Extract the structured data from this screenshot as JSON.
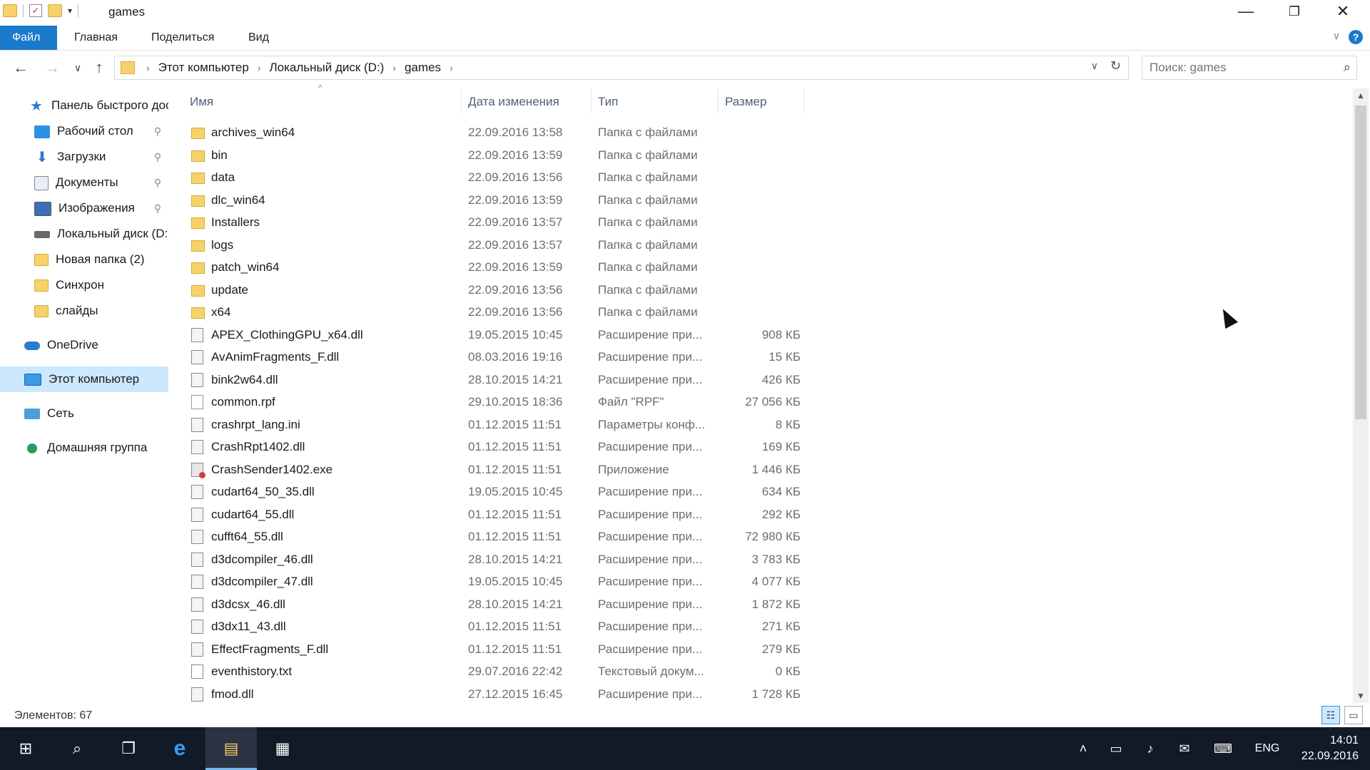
{
  "window": {
    "title": "games",
    "minimize_icon": "—",
    "restore_icon": "❐",
    "close_icon": "✕"
  },
  "ribbon": {
    "tabs": [
      "Файл",
      "Главная",
      "Поделиться",
      "Вид"
    ],
    "help_icon": "?",
    "collapse_icon": "∨"
  },
  "nav": {
    "back_icon": "←",
    "forward_icon": "→",
    "recent_icon": "∨",
    "up_icon": "↑",
    "breadcrumbs": [
      "Этот компьютер",
      "Локальный диск (D:)",
      "games"
    ],
    "crumb_sep": "›",
    "dropdown_icon": "∨",
    "refresh_icon": "↻"
  },
  "search": {
    "placeholder": "Поиск: games",
    "icon": "⌕"
  },
  "sidebar": {
    "items": [
      {
        "label": "Панель быстрого доступа",
        "icon": "star-icon"
      },
      {
        "label": "Рабочий стол",
        "icon": "desktop-icon",
        "pinned": true
      },
      {
        "label": "Загрузки",
        "icon": "downloads-icon",
        "pinned": true
      },
      {
        "label": "Документы",
        "icon": "documents-icon",
        "pinned": true
      },
      {
        "label": "Изображения",
        "icon": "pictures-icon",
        "pinned": true
      },
      {
        "label": "Локальный диск (D:)",
        "icon": "drive-icon"
      },
      {
        "label": "Новая папка (2)",
        "icon": "folder-icon"
      },
      {
        "label": "Синхрон",
        "icon": "folder-icon"
      },
      {
        "label": "слайды",
        "icon": "folder-icon"
      },
      {
        "label": "OneDrive",
        "icon": "onedrive-icon"
      },
      {
        "label": "Этот компьютер",
        "icon": "computer-icon",
        "selected": true
      },
      {
        "label": "Сеть",
        "icon": "network-icon"
      },
      {
        "label": "Домашняя группа",
        "icon": "homegroup-icon"
      }
    ],
    "pin_glyph": "★"
  },
  "columns": {
    "name": "Имя",
    "date": "Дата изменения",
    "type": "Тип",
    "size": "Размер"
  },
  "files": [
    {
      "name": "archives_win64",
      "date": "22.09.2016 13:58",
      "type": "Папка с файлами",
      "size": "",
      "kind": "folder"
    },
    {
      "name": "bin",
      "date": "22.09.2016 13:59",
      "type": "Папка с файлами",
      "size": "",
      "kind": "folder"
    },
    {
      "name": "data",
      "date": "22.09.2016 13:56",
      "type": "Папка с файлами",
      "size": "",
      "kind": "folder"
    },
    {
      "name": "dlc_win64",
      "date": "22.09.2016 13:59",
      "type": "Папка с файлами",
      "size": "",
      "kind": "folder"
    },
    {
      "name": "Installers",
      "date": "22.09.2016 13:57",
      "type": "Папка с файлами",
      "size": "",
      "kind": "folder"
    },
    {
      "name": "logs",
      "date": "22.09.2016 13:57",
      "type": "Папка с файлами",
      "size": "",
      "kind": "folder"
    },
    {
      "name": "patch_win64",
      "date": "22.09.2016 13:59",
      "type": "Папка с файлами",
      "size": "",
      "kind": "folder"
    },
    {
      "name": "update",
      "date": "22.09.2016 13:56",
      "type": "Папка с файлами",
      "size": "",
      "kind": "folder"
    },
    {
      "name": "x64",
      "date": "22.09.2016 13:56",
      "type": "Папка с файлами",
      "size": "",
      "kind": "folder"
    },
    {
      "name": "APEX_ClothingGPU_x64.dll",
      "date": "19.05.2015 10:45",
      "type": "Расширение при...",
      "size": "908 КБ",
      "kind": "dll"
    },
    {
      "name": "AvAnimFragments_F.dll",
      "date": "08.03.2016 19:16",
      "type": "Расширение при...",
      "size": "15 КБ",
      "kind": "dll"
    },
    {
      "name": "bink2w64.dll",
      "date": "28.10.2015 14:21",
      "type": "Расширение при...",
      "size": "426 КБ",
      "kind": "dll"
    },
    {
      "name": "common.rpf",
      "date": "29.10.2015 18:36",
      "type": "Файл \"RPF\"",
      "size": "27 056 КБ",
      "kind": "blank"
    },
    {
      "name": "crashrpt_lang.ini",
      "date": "01.12.2015 11:51",
      "type": "Параметры конф...",
      "size": "8 КБ",
      "kind": "dll"
    },
    {
      "name": "CrashRpt1402.dll",
      "date": "01.12.2015 11:51",
      "type": "Расширение при...",
      "size": "169 КБ",
      "kind": "dll"
    },
    {
      "name": "CrashSender1402.exe",
      "date": "01.12.2015 11:51",
      "type": "Приложение",
      "size": "1 446 КБ",
      "kind": "exe"
    },
    {
      "name": "cudart64_50_35.dll",
      "date": "19.05.2015 10:45",
      "type": "Расширение при...",
      "size": "634 КБ",
      "kind": "dll"
    },
    {
      "name": "cudart64_55.dll",
      "date": "01.12.2015 11:51",
      "type": "Расширение при...",
      "size": "292 КБ",
      "kind": "dll"
    },
    {
      "name": "cufft64_55.dll",
      "date": "01.12.2015 11:51",
      "type": "Расширение при...",
      "size": "72 980 КБ",
      "kind": "dll"
    },
    {
      "name": "d3dcompiler_46.dll",
      "date": "28.10.2015 14:21",
      "type": "Расширение при...",
      "size": "3 783 КБ",
      "kind": "dll"
    },
    {
      "name": "d3dcompiler_47.dll",
      "date": "19.05.2015 10:45",
      "type": "Расширение при...",
      "size": "4 077 КБ",
      "kind": "dll"
    },
    {
      "name": "d3dcsx_46.dll",
      "date": "28.10.2015 14:21",
      "type": "Расширение при...",
      "size": "1 872 КБ",
      "kind": "dll"
    },
    {
      "name": "d3dx11_43.dll",
      "date": "01.12.2015 11:51",
      "type": "Расширение при...",
      "size": "271 КБ",
      "kind": "dll"
    },
    {
      "name": "EffectFragments_F.dll",
      "date": "01.12.2015 11:51",
      "type": "Расширение при...",
      "size": "279 КБ",
      "kind": "dll"
    },
    {
      "name": "eventhistory.txt",
      "date": "29.07.2016 22:42",
      "type": "Текстовый докум...",
      "size": "0 КБ",
      "kind": "txt"
    },
    {
      "name": "fmod.dll",
      "date": "27.12.2015 16:45",
      "type": "Расширение при...",
      "size": "1 728 КБ",
      "kind": "dll"
    }
  ],
  "status": {
    "items_count": "Элементов: 67"
  },
  "taskbar": {
    "start_icon": "⊞",
    "search_icon": "⌕",
    "taskview_icon": "❐",
    "edge_icon": "e",
    "explorer_icon": "▤",
    "store_icon": "▦",
    "tray_up_icon": "˄",
    "network_icon": "▭",
    "volume_icon": "♪",
    "notifications_icon": "✉",
    "keyboard_icon": "⌨",
    "language": "ENG",
    "time": "14:01",
    "date": "22.09.2016"
  }
}
